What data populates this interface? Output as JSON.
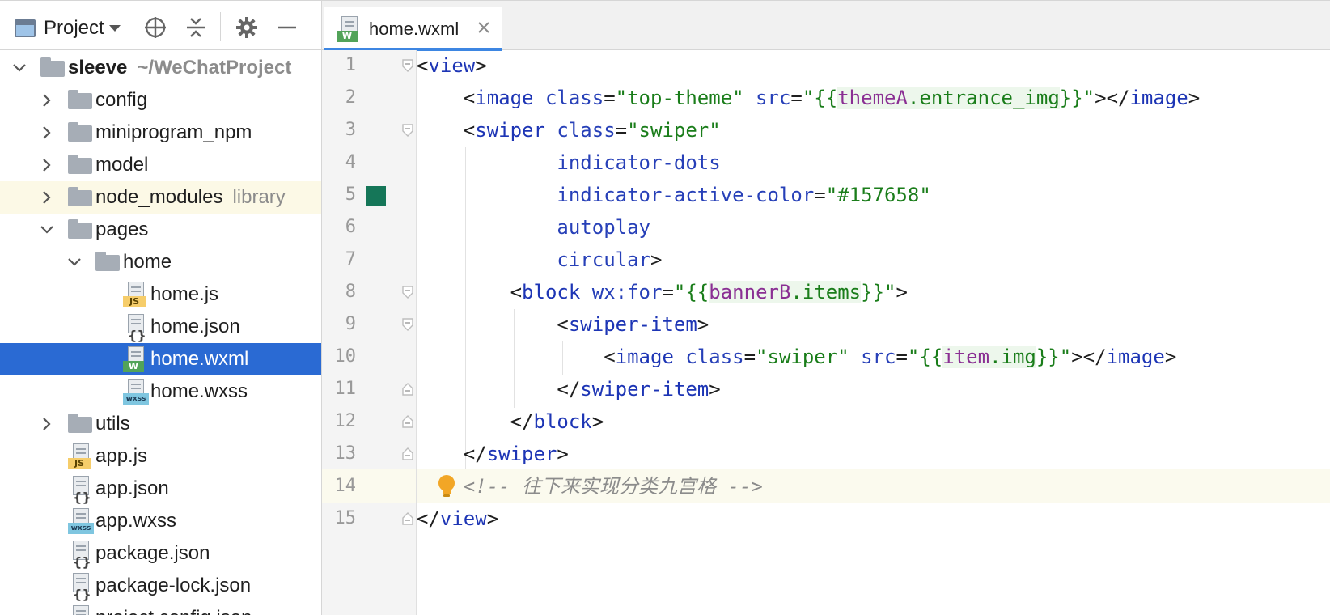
{
  "project": {
    "title": "Project",
    "tree": [
      {
        "label": "sleeve",
        "hint": "~/WeChatProject",
        "type": "folder",
        "depth": 0,
        "expanded": true,
        "bold": true
      },
      {
        "label": "config",
        "type": "folder",
        "depth": 1,
        "expanded": false
      },
      {
        "label": "miniprogram_npm",
        "type": "folder",
        "depth": 1,
        "expanded": false
      },
      {
        "label": "model",
        "type": "folder",
        "depth": 1,
        "expanded": false
      },
      {
        "label": "node_modules",
        "hint": "library",
        "type": "folder",
        "depth": 1,
        "expanded": false,
        "highlight": true
      },
      {
        "label": "pages",
        "type": "folder",
        "depth": 1,
        "expanded": true
      },
      {
        "label": "home",
        "type": "folder",
        "depth": 2,
        "expanded": true
      },
      {
        "label": "home.js",
        "type": "js",
        "depth": 3
      },
      {
        "label": "home.json",
        "type": "json",
        "depth": 3
      },
      {
        "label": "home.wxml",
        "type": "wxml",
        "depth": 3,
        "selected": true
      },
      {
        "label": "home.wxss",
        "type": "wxss",
        "depth": 3
      },
      {
        "label": "utils",
        "type": "folder",
        "depth": 1,
        "expanded": false
      },
      {
        "label": "app.js",
        "type": "js",
        "depth": 1
      },
      {
        "label": "app.json",
        "type": "json",
        "depth": 1
      },
      {
        "label": "app.wxss",
        "type": "wxss",
        "depth": 1
      },
      {
        "label": "package.json",
        "type": "json",
        "depth": 1
      },
      {
        "label": "package-lock.json",
        "type": "json",
        "depth": 1
      },
      {
        "label": "project.config.json",
        "type": "json",
        "depth": 1
      }
    ]
  },
  "file_tags": {
    "js": "JS",
    "json": "{}",
    "wxml": "W",
    "wxss": "wxss"
  },
  "editor": {
    "tab_label": "home.wxml",
    "color_swatch": "#157658",
    "current_line": 14,
    "lines": [
      {
        "n": "1",
        "fold": "open",
        "tokens": [
          [
            "punc",
            "<"
          ],
          [
            "tag",
            "view"
          ],
          [
            "punc",
            ">"
          ]
        ]
      },
      {
        "n": "2",
        "tokens": [
          [
            "punc",
            "    <"
          ],
          [
            "tag",
            "image "
          ],
          [
            "attr",
            "class"
          ],
          [
            "punc",
            "="
          ],
          [
            "str",
            "\"top-theme\" "
          ],
          [
            "attr",
            "src"
          ],
          [
            "punc",
            "="
          ],
          [
            "str",
            "\"{{"
          ],
          [
            "var",
            "themeA"
          ],
          [
            "prop",
            ".entrance_img"
          ],
          [
            "str",
            "}}\""
          ],
          [
            "punc",
            "></"
          ],
          [
            "tag",
            "image"
          ],
          [
            "punc",
            ">"
          ]
        ]
      },
      {
        "n": "3",
        "fold": "open",
        "tokens": [
          [
            "punc",
            "    <"
          ],
          [
            "tag",
            "swiper "
          ],
          [
            "attr",
            "class"
          ],
          [
            "punc",
            "="
          ],
          [
            "str",
            "\"swiper\""
          ]
        ]
      },
      {
        "n": "4",
        "tokens": [
          [
            "attr",
            "            indicator-dots"
          ]
        ]
      },
      {
        "n": "5",
        "swatch": true,
        "tokens": [
          [
            "attr",
            "            indicator-active-color"
          ],
          [
            "punc",
            "="
          ],
          [
            "str",
            "\"#157658\""
          ]
        ]
      },
      {
        "n": "6",
        "tokens": [
          [
            "attr",
            "            autoplay"
          ]
        ]
      },
      {
        "n": "7",
        "tokens": [
          [
            "attr",
            "            circular"
          ],
          [
            "punc",
            ">"
          ]
        ]
      },
      {
        "n": "8",
        "fold": "open",
        "tokens": [
          [
            "punc",
            "        <"
          ],
          [
            "tag",
            "block "
          ],
          [
            "attr",
            "wx:for"
          ],
          [
            "punc",
            "="
          ],
          [
            "str",
            "\"{{"
          ],
          [
            "var",
            "bannerB"
          ],
          [
            "prop",
            ".items"
          ],
          [
            "str",
            "}}\""
          ],
          [
            "punc",
            ">"
          ]
        ]
      },
      {
        "n": "9",
        "fold": "open",
        "tokens": [
          [
            "punc",
            "            <"
          ],
          [
            "tag",
            "swiper-item"
          ],
          [
            "punc",
            ">"
          ]
        ]
      },
      {
        "n": "10",
        "tokens": [
          [
            "punc",
            "                <"
          ],
          [
            "tag",
            "image "
          ],
          [
            "attr",
            "class"
          ],
          [
            "punc",
            "="
          ],
          [
            "str",
            "\"swiper\" "
          ],
          [
            "attr",
            "src"
          ],
          [
            "punc",
            "="
          ],
          [
            "str",
            "\"{{"
          ],
          [
            "var",
            "item"
          ],
          [
            "prop",
            ".img"
          ],
          [
            "str",
            "}}\""
          ],
          [
            "punc",
            "></"
          ],
          [
            "tag",
            "image"
          ],
          [
            "punc",
            ">"
          ]
        ]
      },
      {
        "n": "11",
        "fold": "close",
        "tokens": [
          [
            "punc",
            "            </"
          ],
          [
            "tag",
            "swiper-item"
          ],
          [
            "punc",
            ">"
          ]
        ]
      },
      {
        "n": "12",
        "fold": "close",
        "tokens": [
          [
            "punc",
            "        </"
          ],
          [
            "tag",
            "block"
          ],
          [
            "punc",
            ">"
          ]
        ]
      },
      {
        "n": "13",
        "fold": "close",
        "tokens": [
          [
            "punc",
            "    </"
          ],
          [
            "tag",
            "swiper"
          ],
          [
            "punc",
            ">"
          ]
        ]
      },
      {
        "n": "14",
        "bulb": true,
        "tokens": [
          [
            "com",
            "    <!-- 往下来实现分类九宫格 -->"
          ]
        ]
      },
      {
        "n": "15",
        "fold": "close",
        "tokens": [
          [
            "punc",
            "</"
          ],
          [
            "tag",
            "view"
          ],
          [
            "punc",
            ">"
          ]
        ]
      }
    ]
  }
}
